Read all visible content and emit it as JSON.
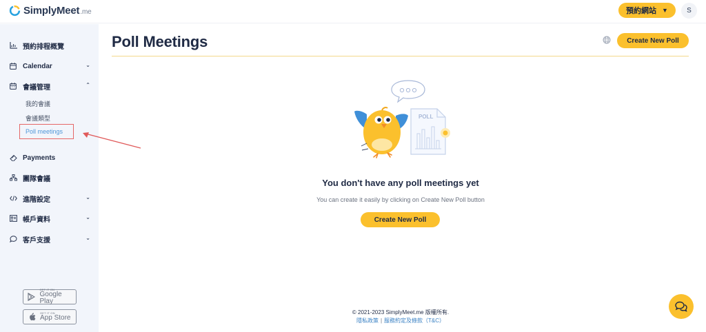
{
  "header": {
    "logo_name": "SimplyMeet",
    "logo_tld": ".me",
    "site_button_label": "預約網站",
    "avatar_initial": "S"
  },
  "sidebar": {
    "items": [
      {
        "label": "預約排程概覽",
        "icon": "chart-icon"
      },
      {
        "label": "Calendar",
        "icon": "calendar-icon",
        "expanded": false
      },
      {
        "label": "會議管理",
        "icon": "meeting-icon",
        "expanded": true
      },
      {
        "label": "Payments",
        "icon": "payments-icon"
      },
      {
        "label": "團隊會議",
        "icon": "team-icon"
      },
      {
        "label": "進階設定",
        "icon": "code-icon",
        "expanded": false
      },
      {
        "label": "帳戶資料",
        "icon": "account-icon",
        "expanded": false
      },
      {
        "label": "客戶支援",
        "icon": "chat-bubble-icon",
        "expanded": false
      }
    ],
    "sub_items": [
      "我的會議",
      "會議類型",
      "Poll meetings"
    ],
    "active_sub_item": "Poll meetings",
    "google_play": {
      "small": "GET IT ON",
      "big": "Google Play"
    },
    "app_store": {
      "small": "GET IT ON",
      "big": "App Store"
    }
  },
  "main": {
    "title": "Poll Meetings",
    "create_button_label": "Create New Poll",
    "illustration_label": "POLL",
    "empty_title": "You don't have any poll meetings yet",
    "empty_subtitle": "You can create it easily by clicking on Create New Poll button",
    "empty_create_label": "Create New Poll"
  },
  "footer": {
    "copyright": "© 2021-2023 SimplyMeet.me 版權所有.",
    "privacy": "隱私政策",
    "divider": "|",
    "terms": "服務約定及條款（T&C）"
  },
  "colors": {
    "accent": "#fbc02d",
    "sidebar_bg": "#f2f5fb",
    "link": "#3b82c4",
    "highlight_border": "#e56666",
    "annotation_arrow": "#e05a5a"
  }
}
